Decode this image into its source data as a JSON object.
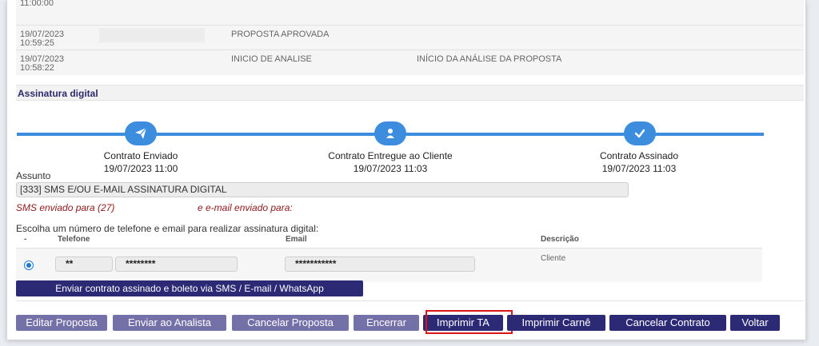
{
  "history": {
    "top_partial_time": "11:00:00",
    "rows": [
      {
        "date": "19/07/2023",
        "time": "10:59:25",
        "status": "PROPOSTA APROVADA",
        "description": ""
      },
      {
        "date": "19/07/2023",
        "time": "10:58:22",
        "status": "INICIO DE ANALISE",
        "description": "INÍCIO DA ANÁLISE DA PROPOSTA"
      }
    ]
  },
  "signature": {
    "section_title": "Assinatura digital",
    "steps": [
      {
        "label": "Contrato Enviado",
        "datetime": "19/07/2023 11:00",
        "icon": "paper-plane-icon"
      },
      {
        "label": "Contrato Entregue ao Cliente",
        "datetime": "19/07/2023 11:03",
        "icon": "user-icon"
      },
      {
        "label": "Contrato Assinado",
        "datetime": "19/07/2023 11:03",
        "icon": "checkmark-icon"
      }
    ],
    "accent_color": "#3c8dde"
  },
  "subject": {
    "label": "Assunto",
    "value": "[333] SMS E/OU E-MAIL ASSINATURA DIGITAL"
  },
  "notices": {
    "sms_sent": "SMS enviado para (27)",
    "email_sent": "e e-mail enviado para:"
  },
  "contact": {
    "prompt": "Escolha um número de telefone e email para realizar assinatura digital:",
    "headers": {
      "select": "-",
      "phone": "Telefone",
      "email": "Email",
      "description": "Descrição"
    },
    "row": {
      "ddd": "**",
      "phone": "********",
      "email": "***********",
      "description": "Cliente",
      "selected": true
    }
  },
  "send_button": "Enviar contrato assinado e boleto via SMS / E-mail / WhatsApp",
  "actions": {
    "edit": "Editar Proposta",
    "send_analyst": "Enviar ao Analista",
    "cancel_proposal": "Cancelar Proposta",
    "close": "Encerrar",
    "print_ta": "Imprimir TA",
    "print_booklet": "Imprimir Carnê",
    "cancel_contract": "Cancelar Contrato",
    "back": "Voltar"
  }
}
